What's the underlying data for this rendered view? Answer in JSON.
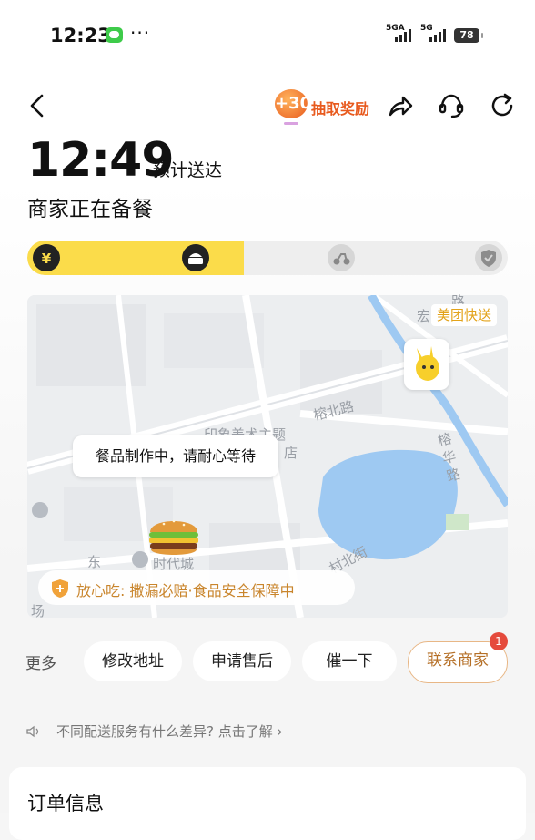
{
  "status_bar": {
    "time": "12:23",
    "more": "···",
    "signal1": "5GA",
    "signal2": "5G",
    "battery": "78"
  },
  "header": {
    "reward_points": "+30",
    "reward_label": "抽取奖励"
  },
  "delivery": {
    "eta_time": "12:49",
    "eta_label": "预计送达",
    "status": "商家正在备餐",
    "progress_fraction": 0.45,
    "steps": [
      "paid",
      "preparing",
      "delivering",
      "delivered"
    ]
  },
  "map": {
    "message": "餐品制作中，请耐心等待",
    "courier_badge": "美团快送",
    "safety_text": "放心吃: 撒漏必赔·食品安全保障中",
    "labels": {
      "hong": "宏",
      "lu_top": "路",
      "rongbei": "榕北路",
      "ronghua": "榕华路",
      "yinxiang": "印象美术主题",
      "dian": "店",
      "dong": "东",
      "shidai": "时代城",
      "chang": "场",
      "cunbei": "村北街"
    }
  },
  "actions": {
    "more": "更多",
    "modify_address": "修改地址",
    "after_sale": "申请售后",
    "urge": "催一下",
    "contact_merchant": "联系商家",
    "contact_badge": "1"
  },
  "tip": {
    "text": "不同配送服务有什么差异? 点击了解 ›"
  },
  "order": {
    "title": "订单信息"
  },
  "colors": {
    "accent_yellow": "#fbdc4a",
    "reward_orange": "#e85a1e",
    "safety_brown": "#c9852c",
    "badge_red": "#e54a3c"
  }
}
